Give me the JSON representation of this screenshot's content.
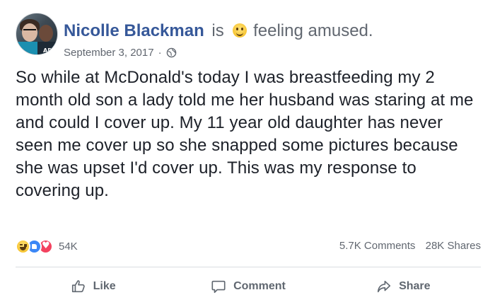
{
  "post": {
    "author": "Nicolle Blackman",
    "is_word": "is",
    "feeling_emoji": "smiling-face-icon",
    "feeling": "feeling amused.",
    "date": "September 3, 2017",
    "separator": "·",
    "privacy_icon": "globe-icon",
    "avatar_tag": "ADP",
    "text": "So while at McDonald's today I was breastfeeding my 2 month old son a lady told me her husband was staring at me and could I cover up. My 11 year old daughter has never seen me cover up so she snapped some pictures because she was upset I'd cover up. This was my response to covering up."
  },
  "reactions": {
    "icons": [
      "haha-reaction-icon",
      "like-reaction-icon",
      "love-reaction-icon"
    ],
    "count": "54K",
    "comments": "5.7K Comments",
    "shares": "28K Shares"
  },
  "actions": {
    "like_label": "Like",
    "comment_label": "Comment",
    "share_label": "Share"
  },
  "colors": {
    "author": "#365899",
    "muted": "#616770",
    "text": "#1d2129",
    "like_blue": "#3b87f6",
    "love_red": "#f3425f"
  }
}
